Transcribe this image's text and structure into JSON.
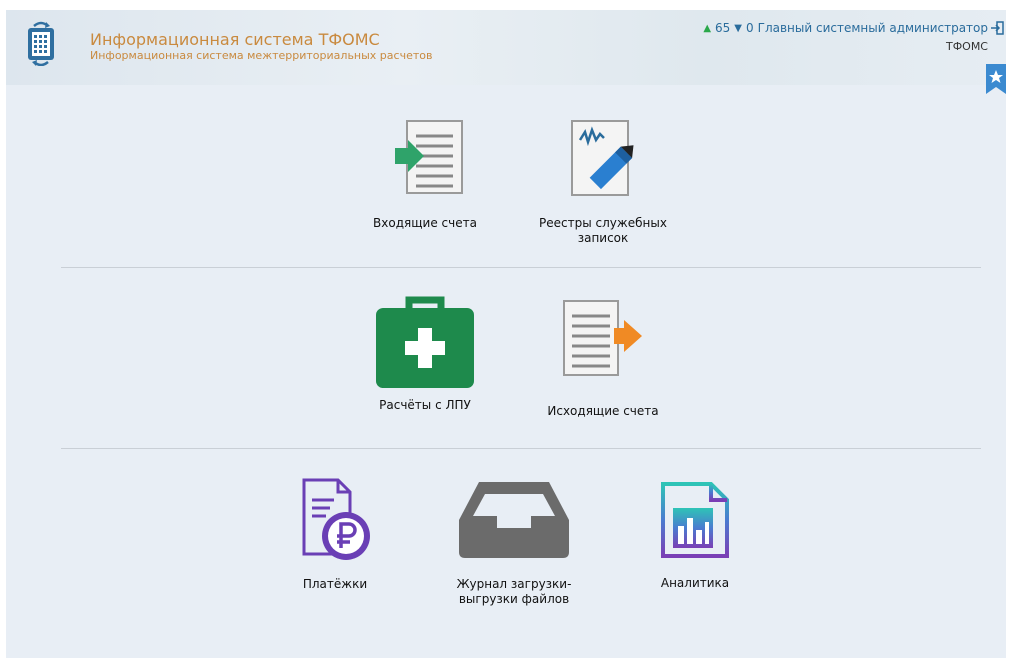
{
  "header": {
    "title": "Информационная система ТФОМС",
    "subtitle": "Информационная система межтерриториальных расчетов",
    "counter_up": "65",
    "counter_down": "0",
    "user_name": "Главный системный администратор",
    "organization": "ТФОМС",
    "logo_icon": "calculator-calendar-icon",
    "logout_icon": "logout-icon",
    "bookmark_icon": "star-bookmark-icon"
  },
  "tiles": [
    {
      "label": "Входящие счета",
      "icon": "incoming-document-icon"
    },
    {
      "label": "Реестры служебных записок",
      "icon": "signed-document-icon"
    },
    {
      "label": "Расчёты с ЛПУ",
      "icon": "medical-case-icon"
    },
    {
      "label": "Исходящие счета",
      "icon": "outgoing-document-icon"
    },
    {
      "label": "Платёжки",
      "icon": "ruble-document-icon"
    },
    {
      "label": "Журнал загрузки-выгрузки файлов",
      "icon": "inbox-tray-icon"
    },
    {
      "label": "Аналитика",
      "icon": "analytics-report-icon"
    }
  ],
  "colors": {
    "title": "#c98a3f",
    "link": "#2a6c9c",
    "green": "#1e8a4c",
    "purple": "#6a3fb5",
    "gray": "#6b6b6b",
    "orange": "#f08a24"
  }
}
